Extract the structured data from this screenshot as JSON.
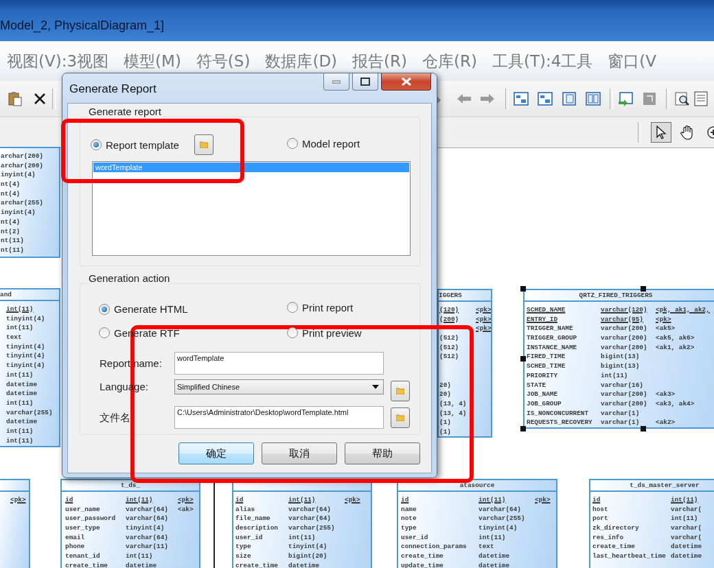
{
  "window": {
    "title": "Model_2, PhysicalDiagram_1]"
  },
  "menu": [
    "视图(V):3视图",
    "模型(M)",
    "符号(S)",
    "数据库(D)",
    "报告(R)",
    "仓库(R)",
    "工具(T):4工具",
    "窗口(V"
  ],
  "palette": [
    {
      "kind": "pointer",
      "selected": true
    },
    {
      "kind": "hand",
      "selected": false
    },
    {
      "kind": "zoom",
      "selected": false
    }
  ],
  "diagram": {
    "tables": [
      {
        "selected": false,
        "rows": [
          {
            "type": "archar(200)"
          },
          {
            "type": "archar(200)"
          },
          {
            "type": "inyint(4)"
          },
          {
            "type": "nt(4)"
          },
          {
            "type": "nt(4)"
          },
          {
            "type": "archar(255)"
          },
          {
            "type": "inyint(4)"
          },
          {
            "type": "nt(4)"
          },
          {
            "type": "nt(2)"
          },
          {
            "type": "nt(11)"
          },
          {
            "type": "nt(11)"
          }
        ]
      },
      {
        "title": "and",
        "selected": false,
        "rows": [
          {
            "type": "int(11)",
            "primary": true
          },
          {
            "type": "tinyint(4)"
          },
          {
            "type": "int(11)"
          },
          {
            "type": "text"
          },
          {
            "type": "tinyint(4)"
          },
          {
            "type": "tinyint(4)"
          },
          {
            "type": "tinyint(4)"
          },
          {
            "type": "int(11)"
          },
          {
            "type": "datetime"
          },
          {
            "type": "datetime"
          },
          {
            "type": "int(11)"
          },
          {
            "type": "varchar(255)"
          },
          {
            "type": "datetime"
          },
          {
            "type": "int(11)"
          },
          {
            "type": "int(11)"
          }
        ]
      },
      {
        "title": "IGGERS",
        "selected": false,
        "rows": [
          {
            "type": "(120)",
            "key": "<pk>",
            "primary": true
          },
          {
            "type": "(200)",
            "key": "<pk>",
            "primary": true
          },
          {
            "key": "<pk>",
            "primary": true
          },
          {
            "type": "(512)"
          },
          {
            "type": "(512)"
          },
          {
            "type": "(512)"
          },
          {},
          {},
          {
            "type": "20)"
          },
          {
            "type": "20)"
          },
          {
            "type": "(13, 4)"
          },
          {
            "type": "(13, 4)"
          },
          {
            "type": "(1)"
          },
          {
            "type": "(1)"
          }
        ]
      },
      {
        "title": "QRTZ_FIRED_TRIGGERS",
        "selected": true,
        "rows": [
          {
            "name": "SCHED_NAME",
            "type": "varchar(120)",
            "key": "<pk, ak1, ak2,",
            "primary": true
          },
          {
            "name": "ENTRY_ID",
            "type": "varchar(95)",
            "key": "<pk>",
            "primary": true
          },
          {
            "name": "TRIGGER_NAME",
            "type": "varchar(200)",
            "key": "<ak5>"
          },
          {
            "name": "TRIGGER_GROUP",
            "type": "varchar(200)",
            "key": "<ak5, ak6>"
          },
          {
            "name": "INSTANCE_NAME",
            "type": "varchar(200)",
            "key": "<ak1, ak2>"
          },
          {
            "name": "FIRED_TIME",
            "type": "bigint(13)"
          },
          {
            "name": "SCHED_TIME",
            "type": "bigint(13)"
          },
          {
            "name": "PRIORITY",
            "type": "int(11)"
          },
          {
            "name": "STATE",
            "type": "varchar(16)"
          },
          {
            "name": "JOB_NAME",
            "type": "varchar(200)",
            "key": "<ak3>"
          },
          {
            "name": "JOB_GROUP",
            "type": "varchar(200)",
            "key": "<ak3, ak4>"
          },
          {
            "name": "IS_NONCONCURRENT",
            "type": "varchar(1)"
          },
          {
            "name": "REQUESTS_RECOVERY",
            "type": "varchar(1)",
            "key": "<ak2>"
          }
        ]
      },
      {
        "selected": false,
        "rows": [
          {
            "key": "<pk>",
            "primary": true
          }
        ]
      },
      {
        "title": "t_ds_",
        "selected": false,
        "rows": [
          {
            "name": "id",
            "type": "int(11)",
            "key": "<pk>",
            "primary": true
          },
          {
            "name": "user_name",
            "type": "varchar(64)",
            "key": "<ak>"
          },
          {
            "name": "user_password",
            "type": "varchar(64)"
          },
          {
            "name": "user_type",
            "type": "tinyint(4)"
          },
          {
            "name": "email",
            "type": "varchar(64)"
          },
          {
            "name": "phone",
            "type": "varchar(11)"
          },
          {
            "name": "tenant_id",
            "type": "int(11)"
          },
          {
            "name": "create_time",
            "type": "datetime"
          }
        ]
      },
      {
        "selected": false,
        "rows": [
          {
            "name": "id",
            "type": "int(11)",
            "key": "<pk>",
            "primary": true
          },
          {
            "name": "alias",
            "type": "varchar(64)"
          },
          {
            "name": "file_name",
            "type": "varchar(64)"
          },
          {
            "name": "description",
            "type": "varchar(255)"
          },
          {
            "name": "user_id",
            "type": "int(11)"
          },
          {
            "name": "type",
            "type": "tinyint(4)"
          },
          {
            "name": "size",
            "type": "bigint(20)"
          },
          {
            "name": "create_time",
            "type": "datetime"
          }
        ]
      },
      {
        "title": "atasource",
        "selected": false,
        "rows": [
          {
            "name": "id",
            "type": "int(11)",
            "key": "<pk>",
            "primary": true
          },
          {
            "name": "name",
            "type": "varchar(64)"
          },
          {
            "name": "note",
            "type": "varchar(255)"
          },
          {
            "name": "type",
            "type": "tinyint(4)"
          },
          {
            "name": "user_id",
            "type": "int(11)"
          },
          {
            "name": "connection_params",
            "type": "text"
          },
          {
            "name": "create_time",
            "type": "datetime"
          },
          {
            "name": "update_time",
            "type": "datetime"
          }
        ]
      },
      {
        "title": "t_ds_master_server",
        "selected": false,
        "rows": [
          {
            "name": "id",
            "type": "int(11)",
            "primary": true
          },
          {
            "name": "host",
            "type": "varchar("
          },
          {
            "name": "port",
            "type": "int(11)"
          },
          {
            "name": "zk_directory",
            "type": "varchar("
          },
          {
            "name": "res_info",
            "type": "varchar("
          },
          {
            "name": "create_time",
            "type": "datetime"
          },
          {
            "name": "last_heartbeat_time",
            "type": "datetime"
          }
        ]
      }
    ]
  },
  "dialog": {
    "title": "Generate Report",
    "report_group": {
      "legend": "Generate report",
      "options": [
        {
          "label": "Report template",
          "selected": true
        },
        {
          "label": "Model report",
          "selected": false
        }
      ],
      "templates": [
        {
          "label": "wordTemplate",
          "selected": true
        }
      ]
    },
    "action_group": {
      "legend": "Generation action",
      "options": [
        {
          "label": "Generate HTML",
          "selected": true
        },
        {
          "label": "Print report",
          "selected": false
        },
        {
          "label": "Generate RTF",
          "selected": false
        },
        {
          "label": "Print preview",
          "selected": false
        }
      ],
      "fields": [
        {
          "kind": "text",
          "label": "Report name:",
          "value": "wordTemplate",
          "browse": false
        },
        {
          "kind": "dropdown",
          "label": "Language:",
          "value": "Simplified Chinese",
          "browse": true
        },
        {
          "kind": "text",
          "label": "文件名",
          "value": "C:\\Users\\Administrator\\Desktop\\wordTemplate.html",
          "browse": true
        }
      ]
    },
    "buttons": [
      {
        "label": "确定",
        "default": true
      },
      {
        "label": "取消",
        "default": false
      },
      {
        "label": "帮助",
        "default": false
      }
    ]
  }
}
